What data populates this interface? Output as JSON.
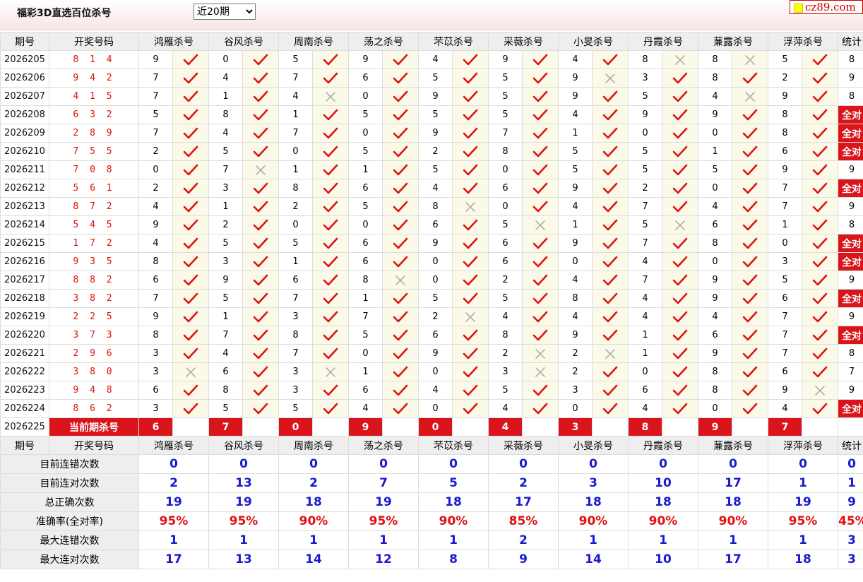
{
  "header": {
    "title": "福彩3D直选百位杀号",
    "period_select": "近20期",
    "site": "cz89.com"
  },
  "columns": {
    "period": "期号",
    "draw": "开奖号码",
    "stat": "统计",
    "killers": [
      "鸿雁杀号",
      "谷风杀号",
      "周南杀号",
      "荡之杀号",
      "芣苡杀号",
      "采薇杀号",
      "小旻杀号",
      "丹霞杀号",
      "蒹露杀号",
      "浮萍杀号"
    ]
  },
  "rows": [
    {
      "period": "2026205",
      "draw": "8 1 4",
      "kills": [
        9,
        0,
        5,
        9,
        4,
        9,
        4,
        8,
        8,
        5
      ],
      "ok": [
        1,
        1,
        1,
        1,
        1,
        1,
        1,
        0,
        0,
        1
      ],
      "stat": "8"
    },
    {
      "period": "2026206",
      "draw": "9 4 2",
      "kills": [
        7,
        4,
        7,
        6,
        5,
        5,
        9,
        3,
        8,
        2
      ],
      "ok": [
        1,
        1,
        1,
        1,
        1,
        1,
        0,
        1,
        1,
        1
      ],
      "stat": "9"
    },
    {
      "period": "2026207",
      "draw": "4 1 5",
      "kills": [
        7,
        1,
        4,
        0,
        9,
        5,
        9,
        5,
        4,
        9
      ],
      "ok": [
        1,
        1,
        0,
        1,
        1,
        1,
        1,
        1,
        0,
        1
      ],
      "stat": "8"
    },
    {
      "period": "2026208",
      "draw": "6 3 2",
      "kills": [
        5,
        8,
        1,
        5,
        5,
        5,
        4,
        9,
        9,
        8
      ],
      "ok": [
        1,
        1,
        1,
        1,
        1,
        1,
        1,
        1,
        1,
        1
      ],
      "stat": "全对"
    },
    {
      "period": "2026209",
      "draw": "2 8 9",
      "kills": [
        7,
        4,
        7,
        0,
        9,
        7,
        1,
        0,
        0,
        8
      ],
      "ok": [
        1,
        1,
        1,
        1,
        1,
        1,
        1,
        1,
        1,
        1
      ],
      "stat": "全对"
    },
    {
      "period": "2026210",
      "draw": "7 5 5",
      "kills": [
        2,
        5,
        0,
        5,
        2,
        8,
        5,
        5,
        1,
        6
      ],
      "ok": [
        1,
        1,
        1,
        1,
        1,
        1,
        1,
        1,
        1,
        1
      ],
      "stat": "全对"
    },
    {
      "period": "2026211",
      "draw": "7 0 8",
      "kills": [
        0,
        7,
        1,
        1,
        5,
        0,
        5,
        5,
        5,
        9
      ],
      "ok": [
        1,
        0,
        1,
        1,
        1,
        1,
        1,
        1,
        1,
        1
      ],
      "stat": "9"
    },
    {
      "period": "2026212",
      "draw": "5 6 1",
      "kills": [
        2,
        3,
        8,
        6,
        4,
        6,
        9,
        2,
        0,
        7
      ],
      "ok": [
        1,
        1,
        1,
        1,
        1,
        1,
        1,
        1,
        1,
        1
      ],
      "stat": "全对"
    },
    {
      "period": "2026213",
      "draw": "8 7 2",
      "kills": [
        4,
        1,
        2,
        5,
        8,
        0,
        4,
        7,
        4,
        7
      ],
      "ok": [
        1,
        1,
        1,
        1,
        0,
        1,
        1,
        1,
        1,
        1
      ],
      "stat": "9"
    },
    {
      "period": "2026214",
      "draw": "5 4 5",
      "kills": [
        9,
        2,
        0,
        0,
        6,
        5,
        1,
        5,
        6,
        1
      ],
      "ok": [
        1,
        1,
        1,
        1,
        1,
        0,
        1,
        0,
        1,
        1
      ],
      "stat": "8"
    },
    {
      "period": "2026215",
      "draw": "1 7 2",
      "kills": [
        4,
        5,
        5,
        6,
        9,
        6,
        9,
        7,
        8,
        0
      ],
      "ok": [
        1,
        1,
        1,
        1,
        1,
        1,
        1,
        1,
        1,
        1
      ],
      "stat": "全对"
    },
    {
      "period": "2026216",
      "draw": "9 3 5",
      "kills": [
        8,
        3,
        1,
        6,
        0,
        6,
        0,
        4,
        0,
        3
      ],
      "ok": [
        1,
        1,
        1,
        1,
        1,
        1,
        1,
        1,
        1,
        1
      ],
      "stat": "全对"
    },
    {
      "period": "2026217",
      "draw": "8 8 2",
      "kills": [
        6,
        9,
        6,
        8,
        0,
        2,
        4,
        7,
        9,
        5
      ],
      "ok": [
        1,
        1,
        1,
        0,
        1,
        1,
        1,
        1,
        1,
        1
      ],
      "stat": "9"
    },
    {
      "period": "2026218",
      "draw": "3 8 2",
      "kills": [
        7,
        5,
        7,
        1,
        5,
        5,
        8,
        4,
        9,
        6
      ],
      "ok": [
        1,
        1,
        1,
        1,
        1,
        1,
        1,
        1,
        1,
        1
      ],
      "stat": "全对"
    },
    {
      "period": "2026219",
      "draw": "2 2 5",
      "kills": [
        9,
        1,
        3,
        7,
        2,
        4,
        4,
        4,
        4,
        7
      ],
      "ok": [
        1,
        1,
        1,
        1,
        0,
        1,
        1,
        1,
        1,
        1
      ],
      "stat": "9"
    },
    {
      "period": "2026220",
      "draw": "3 7 3",
      "kills": [
        8,
        7,
        8,
        5,
        6,
        8,
        9,
        1,
        6,
        7
      ],
      "ok": [
        1,
        1,
        1,
        1,
        1,
        1,
        1,
        1,
        1,
        1
      ],
      "stat": "全对"
    },
    {
      "period": "2026221",
      "draw": "2 9 6",
      "kills": [
        3,
        4,
        7,
        0,
        9,
        2,
        2,
        1,
        9,
        7
      ],
      "ok": [
        1,
        1,
        1,
        1,
        1,
        0,
        0,
        1,
        1,
        1
      ],
      "stat": "8"
    },
    {
      "period": "2026222",
      "draw": "3 8 0",
      "kills": [
        3,
        6,
        3,
        1,
        0,
        3,
        2,
        0,
        8,
        6
      ],
      "ok": [
        0,
        1,
        0,
        1,
        1,
        0,
        1,
        1,
        1,
        1
      ],
      "stat": "7"
    },
    {
      "period": "2026223",
      "draw": "9 4 8",
      "kills": [
        6,
        8,
        3,
        6,
        4,
        5,
        3,
        6,
        8,
        9
      ],
      "ok": [
        1,
        1,
        1,
        1,
        1,
        1,
        1,
        1,
        1,
        0
      ],
      "stat": "9"
    },
    {
      "period": "2026224",
      "draw": "8 6 2",
      "kills": [
        3,
        5,
        5,
        4,
        0,
        4,
        0,
        4,
        0,
        4
      ],
      "ok": [
        1,
        1,
        1,
        1,
        1,
        1,
        1,
        1,
        1,
        1
      ],
      "stat": "全对"
    }
  ],
  "current": {
    "period": "2026225",
    "label": "当前期杀号",
    "kills": [
      6,
      7,
      0,
      9,
      0,
      4,
      3,
      8,
      9,
      7
    ]
  },
  "summary": [
    {
      "label": "目前连错次数",
      "values": [
        "0",
        "0",
        "0",
        "0",
        "0",
        "0",
        "0",
        "0",
        "0",
        "0"
      ],
      "stat": "0",
      "style": "val"
    },
    {
      "label": "目前连对次数",
      "values": [
        "2",
        "13",
        "2",
        "7",
        "5",
        "2",
        "3",
        "10",
        "17",
        "1"
      ],
      "stat": "1",
      "style": "val"
    },
    {
      "label": "总正确次数",
      "values": [
        "19",
        "19",
        "18",
        "19",
        "18",
        "17",
        "18",
        "18",
        "18",
        "19"
      ],
      "stat": "9",
      "style": "val"
    },
    {
      "label": "准确率(全对率)",
      "values": [
        "95%",
        "95%",
        "90%",
        "95%",
        "90%",
        "85%",
        "90%",
        "90%",
        "90%",
        "95%"
      ],
      "stat": "45%",
      "style": "rate"
    },
    {
      "label": "最大连错次数",
      "values": [
        "1",
        "1",
        "1",
        "1",
        "1",
        "2",
        "1",
        "1",
        "1",
        "1"
      ],
      "stat": "3",
      "style": "val"
    },
    {
      "label": "最大连对次数",
      "values": [
        "17",
        "13",
        "14",
        "12",
        "8",
        "9",
        "14",
        "10",
        "17",
        "18"
      ],
      "stat": "3",
      "style": "val"
    }
  ],
  "icons": {
    "ok": "check-icon",
    "miss": "cross-icon"
  },
  "colors": {
    "accent_red": "#d9141a",
    "check": "#e01010",
    "cross": "#b0b0b0",
    "summary_blue": "#1a1ad0"
  }
}
